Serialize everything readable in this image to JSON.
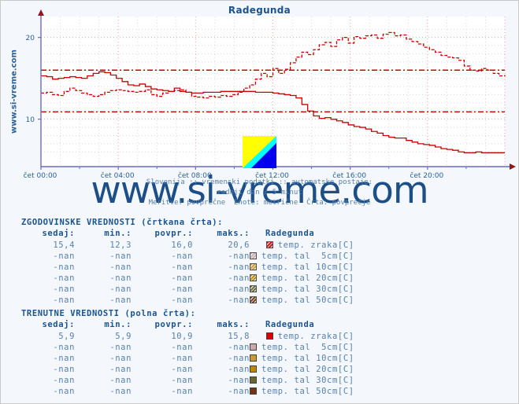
{
  "page": {
    "bg": "#f4f7fc",
    "accent": "#1a5490",
    "value_color": "#5781ad"
  },
  "header": {
    "title": "Radegunda",
    "vertical_label": "www.si-vreme.com",
    "watermark": "www.si-vreme.com"
  },
  "subtitle": {
    "line1": "Slovenija :: vremenski podatki :: avtomatske postaje:",
    "line2": "zadnji dan / 5 minut",
    "line3": "Meritve: povprečne  Enote: metrične  Črta: povprečje"
  },
  "chart_data": {
    "type": "line",
    "title": "Radegunda",
    "xlabel": "",
    "ylabel": "",
    "ylim": [
      4.2,
      21.6
    ],
    "yticks": [
      10,
      20
    ],
    "ytick_labels": [
      "10",
      "20"
    ],
    "xticks": [
      "čet 00:00",
      "čet 04:00",
      "čet 08:00",
      "čet 12:00",
      "čet 16:00",
      "čet 20:00"
    ],
    "xlim_hours": [
      0,
      24
    ],
    "grid": true,
    "legend_position": "below-table",
    "reference_lines": [
      {
        "name": "povprečje zgodovinsko",
        "value": 16.0,
        "style": "dash-dot",
        "color": "#cc0000"
      },
      {
        "name": "povprečje trenutno",
        "value": 10.9,
        "style": "dash-dot",
        "color": "#cc0000"
      }
    ],
    "series": [
      {
        "name": "temp. zraka[C] (zgodovinske)",
        "style": "dashed",
        "color": "#cc0000",
        "x": [
          0.0,
          0.3,
          0.6,
          0.9,
          1.2,
          1.5,
          1.8,
          2.1,
          2.4,
          2.7,
          3.0,
          3.3,
          3.6,
          3.9,
          4.2,
          4.5,
          4.8,
          5.1,
          5.4,
          5.7,
          6.0,
          6.3,
          6.6,
          6.9,
          7.2,
          7.5,
          7.8,
          8.1,
          8.4,
          8.7,
          9.0,
          9.3,
          9.6,
          9.9,
          10.2,
          10.5,
          10.8,
          11.1,
          11.4,
          11.7,
          12.0,
          12.3,
          12.6,
          12.9,
          13.2,
          13.5,
          13.8,
          14.1,
          14.4,
          14.7,
          15.0,
          15.3,
          15.6,
          15.9,
          16.2,
          16.5,
          16.8,
          17.1,
          17.4,
          17.7,
          18.0,
          18.3,
          18.6,
          18.9,
          19.2,
          19.5,
          19.8,
          20.1,
          20.4,
          20.7,
          21.0,
          21.3,
          21.6,
          21.9,
          22.2,
          22.5,
          22.8,
          23.1,
          23.4,
          23.7,
          24.0
        ],
        "y": [
          13.2,
          13.3,
          13.0,
          12.9,
          13.4,
          13.8,
          13.5,
          13.2,
          13.0,
          12.8,
          13.0,
          13.3,
          13.5,
          13.6,
          13.5,
          13.4,
          13.3,
          13.4,
          13.6,
          13.0,
          12.8,
          13.2,
          13.4,
          13.5,
          13.6,
          13.3,
          12.8,
          12.7,
          12.6,
          12.8,
          12.7,
          12.9,
          12.8,
          13.0,
          13.3,
          13.8,
          14.2,
          14.9,
          15.6,
          15.2,
          16.2,
          15.6,
          16.1,
          16.9,
          17.6,
          18.2,
          17.9,
          18.5,
          19.1,
          19.4,
          18.9,
          19.7,
          20.0,
          19.3,
          20.1,
          19.9,
          20.2,
          20.3,
          19.9,
          20.4,
          20.6,
          20.2,
          20.3,
          19.8,
          19.5,
          19.2,
          18.8,
          18.5,
          18.2,
          17.8,
          17.6,
          17.5,
          17.2,
          16.5,
          16.0,
          15.9,
          16.2,
          16.0,
          15.6,
          15.3,
          15.4
        ],
        "stats": {
          "sedaj": "15,4",
          "min": "12,3",
          "povpr": "16,0",
          "maks": "20,6"
        }
      },
      {
        "name": "temp. zraka[C] (trenutne)",
        "style": "solid",
        "color": "#cc0000",
        "x": [
          0.0,
          0.3,
          0.6,
          0.9,
          1.2,
          1.5,
          1.8,
          2.1,
          2.4,
          2.7,
          3.0,
          3.3,
          3.6,
          3.9,
          4.2,
          4.5,
          4.8,
          5.1,
          5.4,
          5.7,
          6.0,
          6.3,
          6.6,
          6.9,
          7.2,
          7.5,
          7.8,
          8.1,
          8.4,
          8.7,
          9.0,
          9.3,
          9.6,
          9.9,
          10.2,
          10.5,
          10.8,
          11.1,
          11.4,
          11.7,
          12.0,
          12.3,
          12.6,
          12.9,
          13.2,
          13.5,
          13.8,
          14.1,
          14.4,
          14.7,
          15.0,
          15.3,
          15.6,
          15.9,
          16.2,
          16.5,
          16.8,
          17.1,
          17.4,
          17.7,
          18.0,
          18.3,
          18.6,
          18.9,
          19.2,
          19.5,
          19.8,
          20.1,
          20.4,
          20.7,
          21.0,
          21.3,
          21.6,
          21.9,
          22.2,
          22.5,
          22.8,
          23.1,
          23.4,
          23.7,
          24.0
        ],
        "y": [
          15.3,
          15.2,
          14.9,
          15.0,
          15.1,
          15.2,
          15.1,
          15.0,
          15.3,
          15.6,
          15.8,
          15.7,
          15.4,
          15.0,
          14.6,
          14.2,
          14.1,
          14.3,
          14.0,
          13.7,
          13.6,
          13.5,
          13.4,
          13.8,
          13.4,
          13.3,
          13.2,
          13.2,
          13.3,
          13.3,
          13.3,
          13.4,
          13.4,
          13.4,
          13.4,
          13.4,
          13.4,
          13.3,
          13.3,
          13.3,
          13.2,
          13.1,
          13.0,
          12.9,
          12.6,
          11.8,
          11.0,
          10.4,
          10.1,
          10.2,
          10.0,
          9.8,
          9.6,
          9.3,
          9.1,
          9.0,
          8.8,
          8.5,
          8.3,
          8.0,
          7.8,
          7.7,
          7.7,
          7.4,
          7.2,
          7.0,
          6.9,
          6.8,
          6.6,
          6.4,
          6.3,
          6.2,
          6.0,
          5.9,
          5.9,
          6.0,
          5.9,
          5.9,
          5.9,
          5.9,
          5.9
        ],
        "stats": {
          "sedaj": "5,9",
          "min": "5,9",
          "povpr": "10,9",
          "maks": "15,8"
        }
      }
    ]
  },
  "tables": [
    {
      "id": "historical",
      "caption": "ZGODOVINSKE VREDNOSTI (črtkana črta):",
      "columns": [
        "sedaj:",
        "min.:",
        "povpr.:",
        "maks.:",
        "Radegunda"
      ],
      "rows": [
        {
          "sedaj": "15,4",
          "min": "12,3",
          "povpr": "16,0",
          "maks": "20,6",
          "label": "temp. zraka[C]",
          "color": "#dd0000",
          "swatch_style": "dashed"
        },
        {
          "sedaj": "-nan",
          "min": "-nan",
          "povpr": "-nan",
          "maks": "-nan",
          "label": "temp. tal  5cm[C]",
          "color": "#ccaaaa",
          "swatch_style": "dashed"
        },
        {
          "sedaj": "-nan",
          "min": "-nan",
          "povpr": "-nan",
          "maks": "-nan",
          "label": "temp. tal 10cm[C]",
          "color": "#cc9933",
          "swatch_style": "dashed"
        },
        {
          "sedaj": "-nan",
          "min": "-nan",
          "povpr": "-nan",
          "maks": "-nan",
          "label": "temp. tal 20cm[C]",
          "color": "#bb8800",
          "swatch_style": "dashed"
        },
        {
          "sedaj": "-nan",
          "min": "-nan",
          "povpr": "-nan",
          "maks": "-nan",
          "label": "temp. tal 30cm[C]",
          "color": "#666633",
          "swatch_style": "dashed"
        },
        {
          "sedaj": "-nan",
          "min": "-nan",
          "povpr": "-nan",
          "maks": "-nan",
          "label": "temp. tal 50cm[C]",
          "color": "#773311",
          "swatch_style": "dashed"
        }
      ]
    },
    {
      "id": "current",
      "caption": "TRENUTNE VREDNOSTI (polna črta):",
      "columns": [
        "sedaj:",
        "min.:",
        "povpr.:",
        "maks.:",
        "Radegunda"
      ],
      "rows": [
        {
          "sedaj": "5,9",
          "min": "5,9",
          "povpr": "10,9",
          "maks": "15,8",
          "label": "temp. zraka[C]",
          "color": "#dd0000",
          "swatch_style": "solid"
        },
        {
          "sedaj": "-nan",
          "min": "-nan",
          "povpr": "-nan",
          "maks": "-nan",
          "label": "temp. tal  5cm[C]",
          "color": "#ccaaaa",
          "swatch_style": "solid"
        },
        {
          "sedaj": "-nan",
          "min": "-nan",
          "povpr": "-nan",
          "maks": "-nan",
          "label": "temp. tal 10cm[C]",
          "color": "#cc9933",
          "swatch_style": "solid"
        },
        {
          "sedaj": "-nan",
          "min": "-nan",
          "povpr": "-nan",
          "maks": "-nan",
          "label": "temp. tal 20cm[C]",
          "color": "#bb8800",
          "swatch_style": "solid"
        },
        {
          "sedaj": "-nan",
          "min": "-nan",
          "povpr": "-nan",
          "maks": "-nan",
          "label": "temp. tal 30cm[C]",
          "color": "#666633",
          "swatch_style": "solid"
        },
        {
          "sedaj": "-nan",
          "min": "-nan",
          "povpr": "-nan",
          "maks": "-nan",
          "label": "temp. tal 50cm[C]",
          "color": "#773311",
          "swatch_style": "solid"
        }
      ]
    }
  ]
}
